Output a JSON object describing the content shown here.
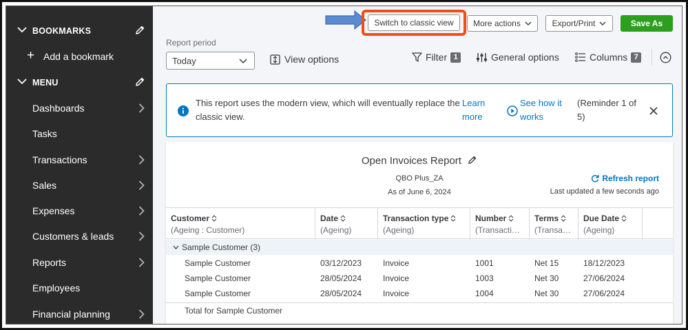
{
  "sidebar": {
    "bookmarks_label": "BOOKMARKS",
    "add_bookmark": "Add a bookmark",
    "menu_label": "MENU",
    "items": [
      {
        "label": "Dashboards",
        "has_arrow": true
      },
      {
        "label": "Tasks",
        "has_arrow": false
      },
      {
        "label": "Transactions",
        "has_arrow": true
      },
      {
        "label": "Sales",
        "has_arrow": true
      },
      {
        "label": "Expenses",
        "has_arrow": true
      },
      {
        "label": "Customers & leads",
        "has_arrow": true
      },
      {
        "label": "Reports",
        "has_arrow": true
      },
      {
        "label": "Employees",
        "has_arrow": false
      },
      {
        "label": "Financial planning",
        "has_arrow": true
      }
    ]
  },
  "toolbar": {
    "switch_classic": "Switch to classic view",
    "more_actions": "More actions",
    "export_print": "Export/Print",
    "save_as": "Save As"
  },
  "controls": {
    "report_period_label": "Report period",
    "report_period_value": "Today",
    "view_options": "View options",
    "filter": "Filter",
    "filter_count": "1",
    "general_options": "General options",
    "columns": "Columns",
    "columns_count": "7"
  },
  "banner": {
    "message": "This report uses the modern view, which will eventually replace the classic view.",
    "learn_more": "Learn more",
    "see_how": "See how it works",
    "reminder": "(Reminder 1 of 5)"
  },
  "report": {
    "title": "Open Invoices Report",
    "company": "QBO Plus_ZA",
    "as_of": "As of June 6, 2024",
    "refresh": "Refresh report",
    "last_updated": "Last updated a few seconds ago",
    "columns": [
      {
        "title": "Customer",
        "sub": "(Ageing : Customer)"
      },
      {
        "title": "Date",
        "sub": "(Ageing)"
      },
      {
        "title": "Transaction type",
        "sub": "(Ageing)"
      },
      {
        "title": "Number",
        "sub": "(Transacti…"
      },
      {
        "title": "Terms",
        "sub": "(Transa…"
      },
      {
        "title": "Due Date",
        "sub": "(Ageing)"
      }
    ],
    "group_label": "Sample Customer (3)",
    "rows": [
      {
        "customer": "Sample Customer",
        "date": "03/12/2023",
        "type": "Invoice",
        "number": "1001",
        "terms": "Net 15",
        "due": "18/12/2023"
      },
      {
        "customer": "Sample Customer",
        "date": "28/05/2024",
        "type": "Invoice",
        "number": "1003",
        "terms": "Net 30",
        "due": "27/06/2024"
      },
      {
        "customer": "Sample Customer",
        "date": "28/05/2024",
        "type": "Invoice",
        "number": "1004",
        "terms": "Net 30",
        "due": "27/06/2024"
      }
    ],
    "total_label": "Total for Sample Customer"
  },
  "colors": {
    "sidebar_bg": "#2b2b2b",
    "accent_blue": "#0077c5",
    "save_green": "#2ca01c",
    "highlight_orange": "#f04e17",
    "annotation_arrow": "#5b8bd0"
  }
}
